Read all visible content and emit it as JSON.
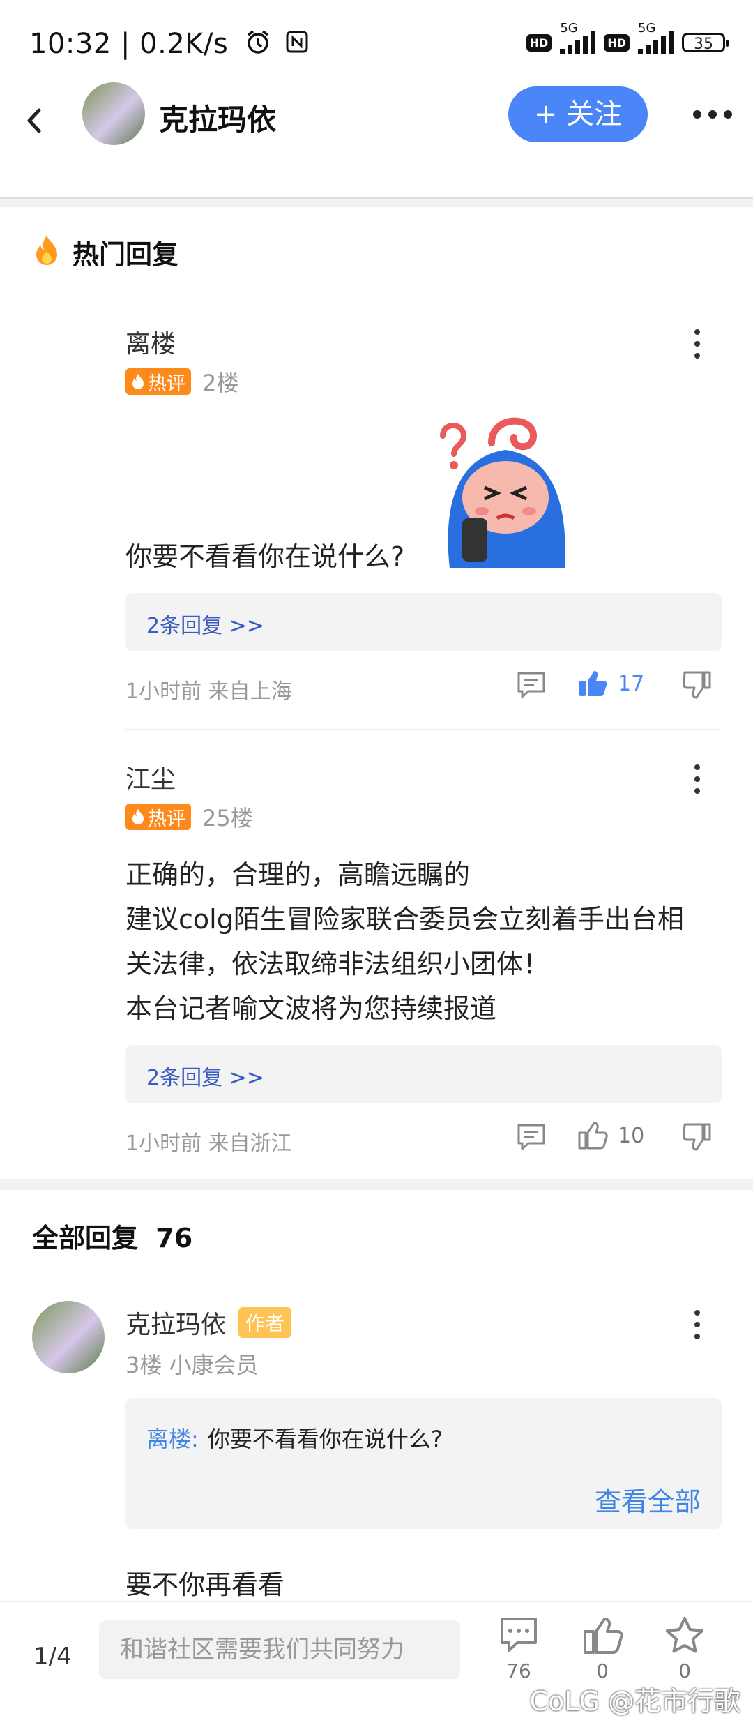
{
  "status_bar": {
    "time_speed": "10:32 | 0.2K/s",
    "network_left": "5G",
    "network_right": "5G",
    "hd1": "HD",
    "hd2": "HD",
    "battery": "35"
  },
  "header": {
    "title": "克拉玛依",
    "follow_label": "+ 关注"
  },
  "hot_section": {
    "title": "热门回复",
    "badge_label": "热评",
    "comments": [
      {
        "user": "离楼",
        "floor": "2楼",
        "text": "你要不看看你在说什么?",
        "replies_link": "2条回复 >>",
        "time_location": "1小时前 来自上海",
        "likes": "17"
      },
      {
        "user": "江尘",
        "floor": "25楼",
        "lines": [
          "正确的，合理的，高瞻远瞩的",
          "建议colg陌生冒险家联合委员会立刻着手出台相",
          "关法律，依法取缔非法组织小团体！",
          "本台记者喻文波将为您持续报道"
        ],
        "replies_link": "2条回复 >>",
        "time_location": "1小时前 来自浙江",
        "likes": "10"
      }
    ]
  },
  "all_section": {
    "title": "全部回复",
    "count": "76",
    "first_reply": {
      "user": "克拉玛依",
      "author_badge": "作者",
      "meta": "3楼 小康会员",
      "quote_name": "离楼:",
      "quote_text": "你要不看看你在说什么?",
      "view_all": "查看全部",
      "text": "要不你再看看"
    }
  },
  "bottom_bar": {
    "page": "1/4",
    "input_placeholder": "和谐社区需要我们共同努力",
    "comments": "76",
    "likes": "0",
    "favorites": "0"
  },
  "watermark": "CoLG @花市行歌",
  "colors": {
    "accent": "#4a86f7",
    "hot_badge": "#ff8a1c",
    "author_badge": "#ffc255",
    "link": "#3a5bbf"
  }
}
